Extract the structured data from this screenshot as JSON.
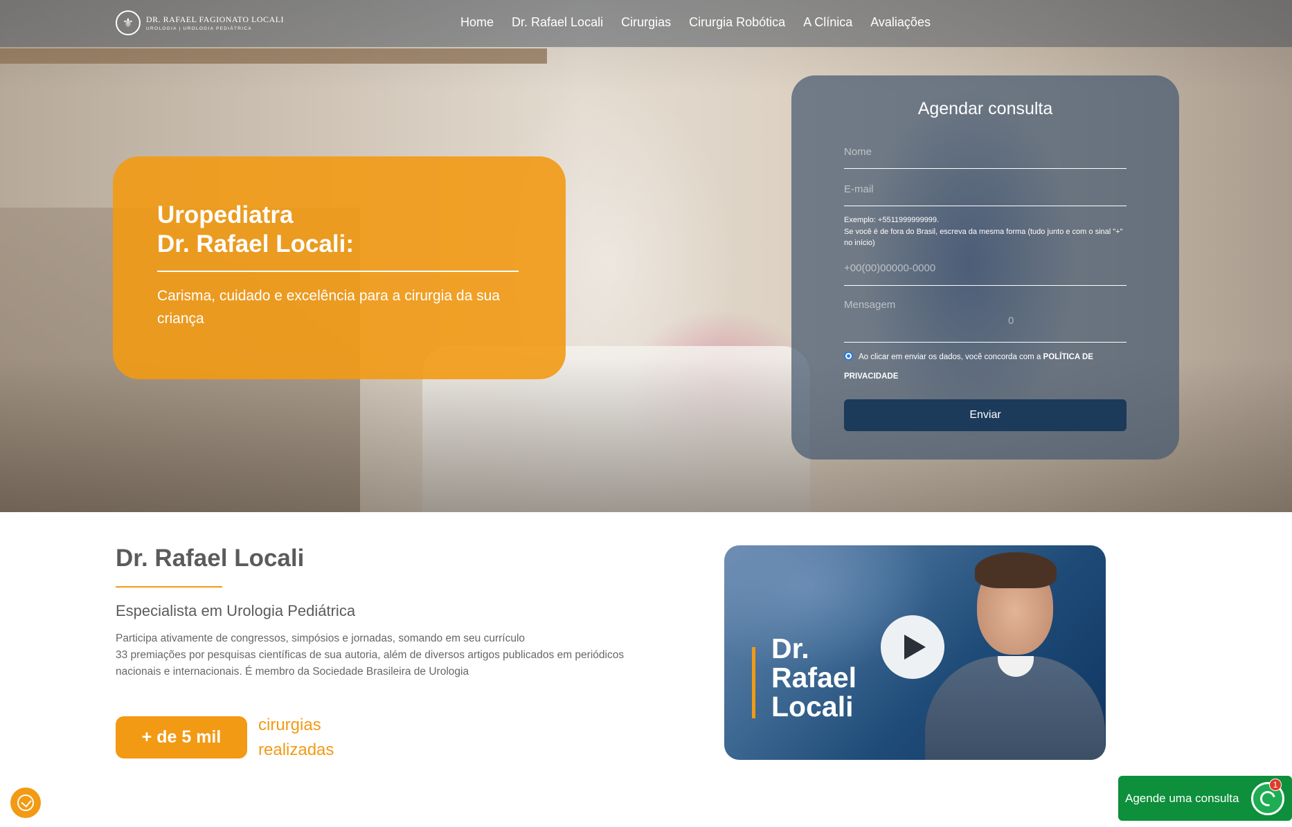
{
  "header": {
    "logo_name": "DR. RAFAEL FAGIONATO LOCALI",
    "logo_sub": "UROLOGIA | UROLOGIA PEDIÁTRICA",
    "nav": [
      "Home",
      "Dr. Rafael Locali",
      "Cirurgias",
      "Cirurgia Robótica",
      "A Clínica",
      "Avaliações"
    ]
  },
  "hero": {
    "title_line1": "Uropediatra",
    "title_line2": "Dr. Rafael Locali:",
    "subtitle": "Carisma, cuidado e excelência para a cirurgia da sua criança"
  },
  "form": {
    "title": "Agendar consulta",
    "name_placeholder": "Nome",
    "email_placeholder": "E-mail",
    "phone_hint_line1": "Exemplo: +5511999999999.",
    "phone_hint_line2": "Se você é de fora do Brasil, escreva da mesma forma (tudo junto e com o sinal \"+\" no início)",
    "phone_placeholder": "+00(00)00000-0000",
    "message_placeholder": "Mensagem",
    "char_counter": "0",
    "consent_text": "Ao clicar em enviar os dados, você concorda com a ",
    "consent_link": "POLÍTICA DE PRIVACIDADE",
    "submit_label": "Enviar"
  },
  "about": {
    "title": "Dr. Rafael Locali",
    "subtitle": "Especialista em Urologia Pediátrica",
    "text_line1": "Participa ativamente de congressos, simpósios e jornadas, somando em seu currículo",
    "text_line2": "33 premiações por pesquisas científicas de sua autoria, além de diversos artigos publicados em periódicos nacionais e internacionais. É membro da Sociedade Brasileira de Urologia",
    "stat_value": "+ de 5 mil",
    "stat_label": "cirurgias realizadas"
  },
  "video": {
    "name_line1": "Dr.",
    "name_line2": "Rafael",
    "name_line3": "Locali"
  },
  "whatsapp": {
    "label": "Agende uma consulta",
    "badge": "1"
  },
  "colors": {
    "accent_orange": "#f29a14",
    "navy": "#1c3a5a",
    "whatsapp_green": "#0e8f3b"
  }
}
